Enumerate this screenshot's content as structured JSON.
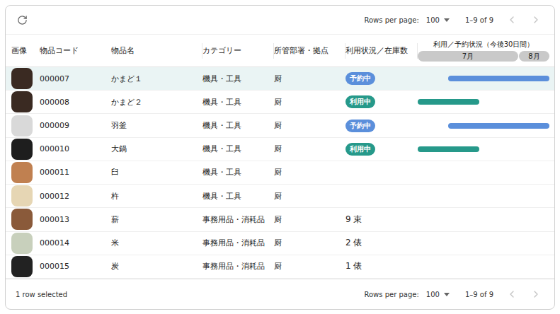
{
  "toolbar": {
    "rows_per_page_label": "Rows per page:",
    "rows_per_page": "100",
    "range": "1–9 of 9",
    "prev_disabled": true,
    "next_disabled": true
  },
  "table": {
    "columns": [
      "画像",
      "物品コード",
      "物品名",
      "カテゴリー",
      "所管部署・拠点",
      "利用状況／在庫数"
    ],
    "timeline": {
      "title": "利用／予約状況（今後30日間）",
      "span_days": 30,
      "months": [
        {
          "label": "7月",
          "days": 23
        },
        {
          "label": "8月",
          "days": 7
        }
      ]
    },
    "rows": [
      {
        "thumb_color": "#3a2a22",
        "code": "000007",
        "name": "かまど１",
        "category": "機具・工具",
        "dept": "厨",
        "selected": true,
        "status": {
          "kind": "badge",
          "text": "予約中",
          "color": "#5b8fdb"
        },
        "bar": {
          "from": 7,
          "to": 30,
          "color": "#5b8fdb"
        }
      },
      {
        "thumb_color": "#3a2a22",
        "code": "000008",
        "name": "かまど２",
        "category": "機具・工具",
        "dept": "厨",
        "selected": false,
        "status": {
          "kind": "badge",
          "text": "利用中",
          "color": "#26998a"
        },
        "bar": {
          "from": 0,
          "to": 14,
          "color": "#26998a"
        }
      },
      {
        "thumb_color": "#d9d9d9",
        "code": "000009",
        "name": "羽釜",
        "category": "機具・工具",
        "dept": "厨",
        "selected": false,
        "status": {
          "kind": "badge",
          "text": "予約中",
          "color": "#5b8fdb"
        },
        "bar": {
          "from": 7,
          "to": 30,
          "color": "#5b8fdb"
        }
      },
      {
        "thumb_color": "#1e1e1e",
        "code": "000010",
        "name": "大鍋",
        "category": "機具・工具",
        "dept": "厨",
        "selected": false,
        "status": {
          "kind": "badge",
          "text": "利用中",
          "color": "#26998a"
        },
        "bar": {
          "from": 0,
          "to": 14,
          "color": "#26998a"
        }
      },
      {
        "thumb_color": "#c08050",
        "code": "000011",
        "name": "臼",
        "category": "機具・工具",
        "dept": "厨",
        "selected": false,
        "status": {
          "kind": "none",
          "text": "",
          "color": "#ffffff"
        },
        "bar": null
      },
      {
        "thumb_color": "#e6d6b4",
        "code": "000012",
        "name": "杵",
        "category": "機具・工具",
        "dept": "厨",
        "selected": false,
        "status": {
          "kind": "none",
          "text": "",
          "color": "#ffffff"
        },
        "bar": null
      },
      {
        "thumb_color": "#8a5a3a",
        "code": "000013",
        "name": "薪",
        "category": "事務用品・消耗品",
        "dept": "厨",
        "selected": false,
        "status": {
          "kind": "stock",
          "text": "9 束",
          "color": "#222222"
        },
        "bar": null
      },
      {
        "thumb_color": "#c8d0bc",
        "code": "000014",
        "name": "米",
        "category": "事務用品・消耗品",
        "dept": "厨",
        "selected": false,
        "status": {
          "kind": "stock",
          "text": "2 俵",
          "color": "#222222"
        },
        "bar": null
      },
      {
        "thumb_color": "#222222",
        "code": "000015",
        "name": "炭",
        "category": "事務用品・消耗品",
        "dept": "厨",
        "selected": false,
        "status": {
          "kind": "stock",
          "text": "1 俵",
          "color": "#222222"
        },
        "bar": null
      }
    ]
  },
  "footer": {
    "selection": "1 row selected",
    "rows_per_page_label": "Rows per page:",
    "rows_per_page": "100",
    "range": "1–9 of 9",
    "prev_disabled": true,
    "next_disabled": true
  }
}
